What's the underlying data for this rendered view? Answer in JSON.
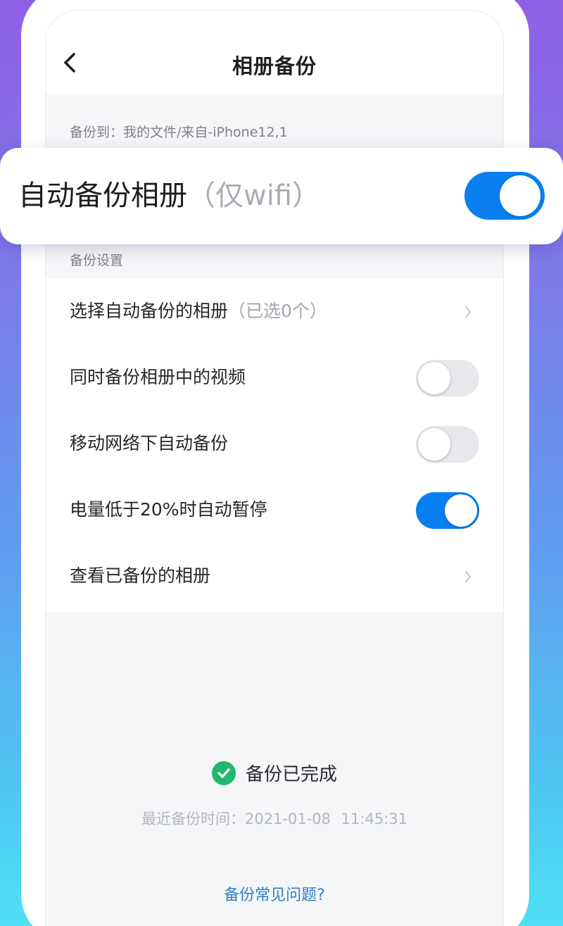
{
  "nav": {
    "title": "相册备份",
    "back_icon": "chevron-left-icon"
  },
  "backup_destination": "备份到：我的文件/来自-iPhone12,1",
  "auto_backup": {
    "label": "自动备份相册",
    "hint": "（仅wifi）",
    "enabled": true
  },
  "settings": {
    "header": "备份设置",
    "rows": [
      {
        "label": "选择自动备份的相册",
        "hint": "（已选0个）",
        "type": "link"
      },
      {
        "label": "同时备份相册中的视频",
        "type": "toggle",
        "enabled": false
      },
      {
        "label": "移动网络下自动备份",
        "type": "toggle",
        "enabled": false
      },
      {
        "label": "电量低于20%时自动暂停",
        "type": "toggle",
        "enabled": true
      },
      {
        "label": "查看已备份的相册",
        "type": "link"
      }
    ]
  },
  "status": {
    "text": "备份已完成",
    "icon": "check-circle-icon",
    "last_backup": "最近备份时间：2021-01-08 11:45:31"
  },
  "faq_link": "备份常见问题?",
  "colors": {
    "accent": "#0a7ff2",
    "success": "#1fb86e",
    "link": "#2f7fc8"
  }
}
